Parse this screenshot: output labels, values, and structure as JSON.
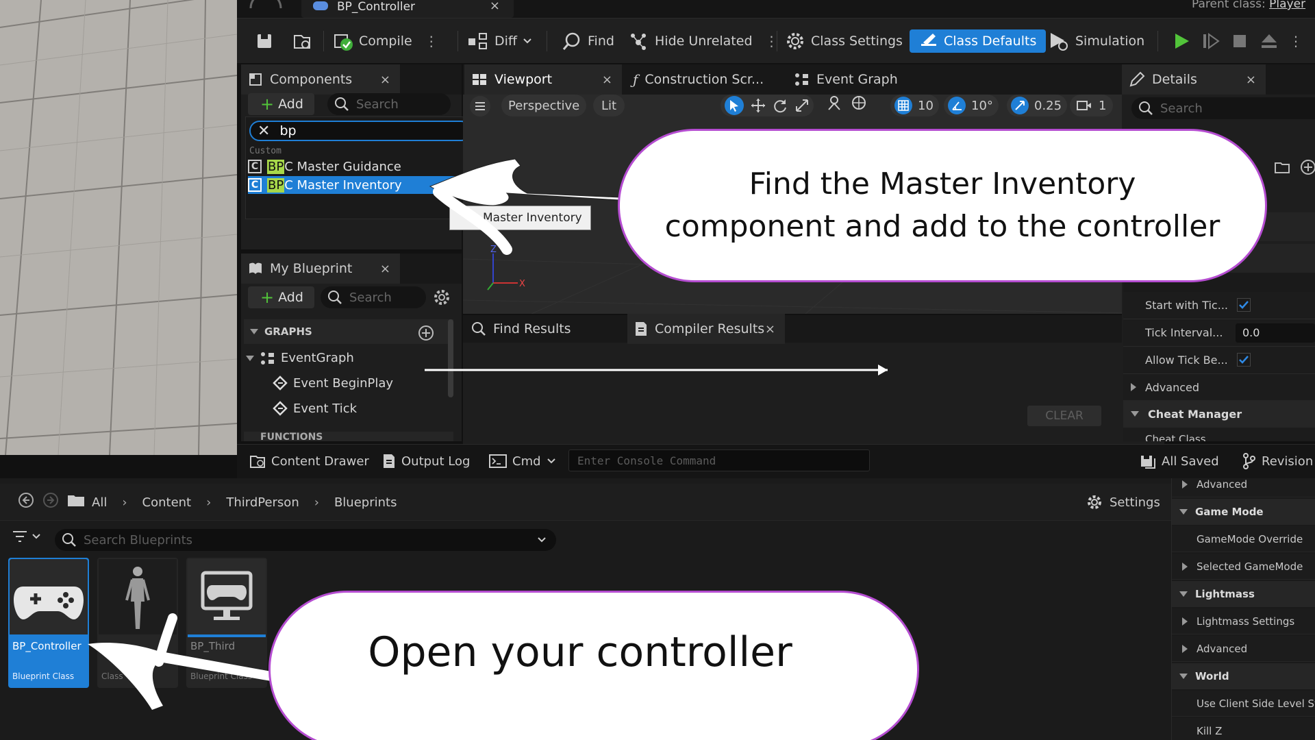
{
  "window": {
    "tab_title": "BP_Controller",
    "parent_class_label": "Parent class:",
    "parent_class_value": "Player"
  },
  "toolbar": {
    "compile": "Compile",
    "diff": "Diff",
    "find": "Find",
    "hide_unrelated": "Hide Unrelated",
    "class_settings": "Class Settings",
    "class_defaults": "Class Defaults",
    "simulation": "Simulation"
  },
  "components": {
    "title": "Components",
    "add": "Add",
    "search_placeholder": "Search",
    "filter_value": "bp",
    "category": "Custom",
    "items": [
      {
        "highlight": "BP",
        "rest": "C Master Guidance"
      },
      {
        "highlight": "BP",
        "rest": "C Master Inventory"
      }
    ],
    "tooltip": "Master Inventory"
  },
  "my_blueprint": {
    "title": "My Blueprint",
    "add": "Add",
    "search_placeholder": "Search",
    "graphs_header": "GRAPHS",
    "event_graph": "EventGraph",
    "events": [
      "Event BeginPlay",
      "Event Tick"
    ],
    "functions_header": "FUNCTIONS"
  },
  "viewport": {
    "tabs": [
      "Viewport",
      "Construction Scr...",
      "Event Graph"
    ],
    "perspective": "Perspective",
    "lit": "Lit",
    "grid_snap": "10",
    "rot_snap": "10°",
    "scale_snap": "0.25",
    "camera_speed": "1"
  },
  "results": {
    "find_results": "Find Results",
    "compiler_results": "Compiler Results",
    "clear": "CLEAR"
  },
  "details": {
    "title": "Details",
    "search_placeholder": "Search",
    "rows": [
      {
        "label": "Start with Tic...",
        "type": "check"
      },
      {
        "label": "Tick Interval...",
        "type": "value",
        "value": "0.0"
      },
      {
        "label": "Allow Tick Be...",
        "type": "check"
      }
    ],
    "advanced": "Advanced",
    "cheat_manager": "Cheat Manager",
    "cheat_class": "Cheat Class"
  },
  "statusbar": {
    "content_drawer": "Content Drawer",
    "output_log": "Output Log",
    "cmd": "Cmd",
    "console_placeholder": "Enter Console Command",
    "all_saved": "All Saved",
    "revision": "Revision"
  },
  "content_browser": {
    "breadcrumb": [
      "All",
      "Content",
      "ThirdPerson",
      "Blueprints"
    ],
    "settings": "Settings",
    "search_placeholder": "Search Blueprints",
    "assets": [
      {
        "name": "BP_Controller",
        "type": "Blueprint Class"
      },
      {
        "name": "",
        "type": "Class"
      },
      {
        "name": "BP_Third",
        "type": "Blueprint Class"
      }
    ]
  },
  "world_settings": {
    "items": [
      {
        "label": "Advanced",
        "kind": "sub"
      },
      {
        "label": "Game Mode",
        "kind": "header"
      },
      {
        "label": "GameMode Override",
        "kind": "field"
      },
      {
        "label": "Selected GameMode",
        "kind": "sub"
      },
      {
        "label": "Lightmass",
        "kind": "header"
      },
      {
        "label": "Lightmass Settings",
        "kind": "sub"
      },
      {
        "label": "Advanced",
        "kind": "sub"
      },
      {
        "label": "World",
        "kind": "header"
      },
      {
        "label": "Use Client Side Level St",
        "kind": "field"
      },
      {
        "label": "Kill Z",
        "kind": "field"
      }
    ]
  },
  "callouts": {
    "top_line1": "Find the Master Inventory",
    "top_line2": "component and add to the controller",
    "bottom": "Open your controller"
  },
  "colors": {
    "accent_blue": "#1f7fd6",
    "callout_border": "#b54dd1",
    "highlight_bp": "#a7d84a",
    "play_green": "#52c43a"
  }
}
